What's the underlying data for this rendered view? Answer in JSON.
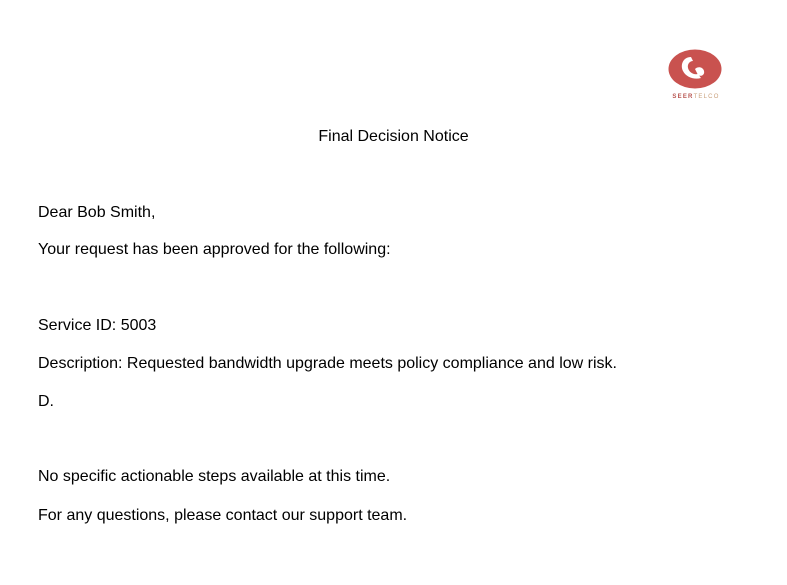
{
  "brand": {
    "name_part1": "SEER",
    "name_part2": "TELCO",
    "logo_color": "#c9524f",
    "icon": "seertelco-logo-icon"
  },
  "notice": {
    "title": "Final Decision Notice",
    "greeting": "Dear Bob Smith,",
    "intro": "Your request has been approved for the following:",
    "service_id": "Service ID: 5003",
    "description": "Description: Requested bandwidth upgrade meets policy compliance and low risk.",
    "extra": "D.",
    "next_steps": "No specific actionable steps available at this time.",
    "contact": "For any questions, please contact our support team."
  }
}
